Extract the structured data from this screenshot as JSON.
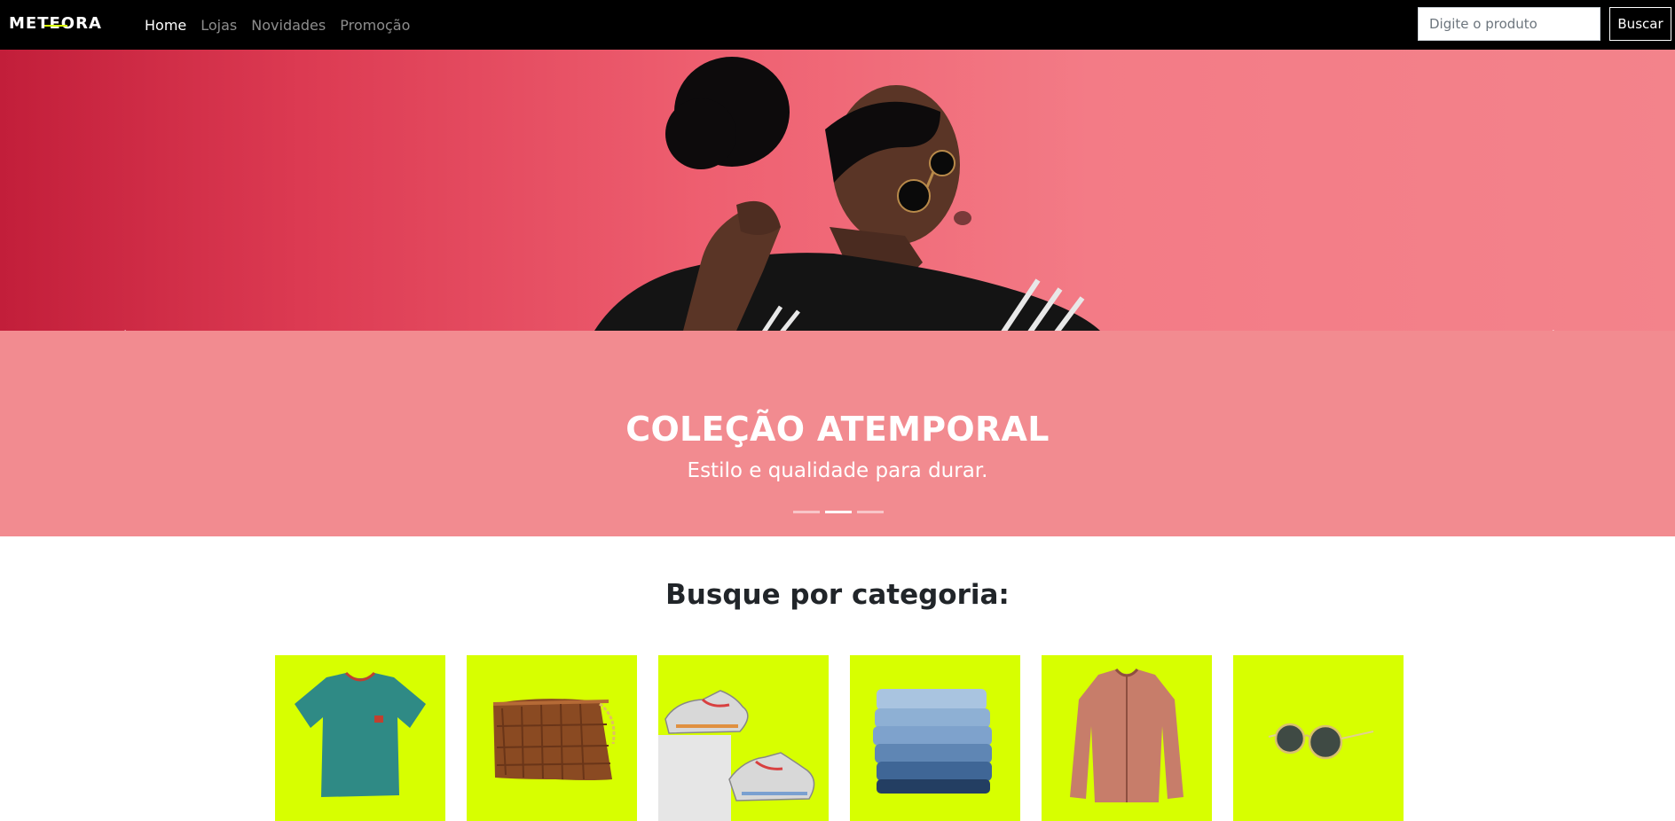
{
  "brand": {
    "logo_text": "METEORA",
    "accent": "#d7ff00"
  },
  "nav": {
    "items": [
      {
        "label": "Home",
        "active": true
      },
      {
        "label": "Lojas",
        "active": false
      },
      {
        "label": "Novidades",
        "active": false
      },
      {
        "label": "Promoção",
        "active": false
      }
    ]
  },
  "search": {
    "placeholder": "Digite o produto",
    "value": "",
    "button_label": "Buscar"
  },
  "hero": {
    "title": "COLEÇÃO ATEMPORAL",
    "subtitle": "Estilo e qualidade para durar.",
    "slides": 3,
    "active_slide": 1,
    "background": "#f28b90"
  },
  "categories": {
    "title": "Busque por categoria:",
    "items": [
      {
        "icon": "tshirt-icon"
      },
      {
        "icon": "bag-icon"
      },
      {
        "icon": "sneakers-icon"
      },
      {
        "icon": "jeans-icon"
      },
      {
        "icon": "jacket-icon"
      },
      {
        "icon": "sunglasses-icon"
      }
    ],
    "card_color": "#d7ff00"
  }
}
